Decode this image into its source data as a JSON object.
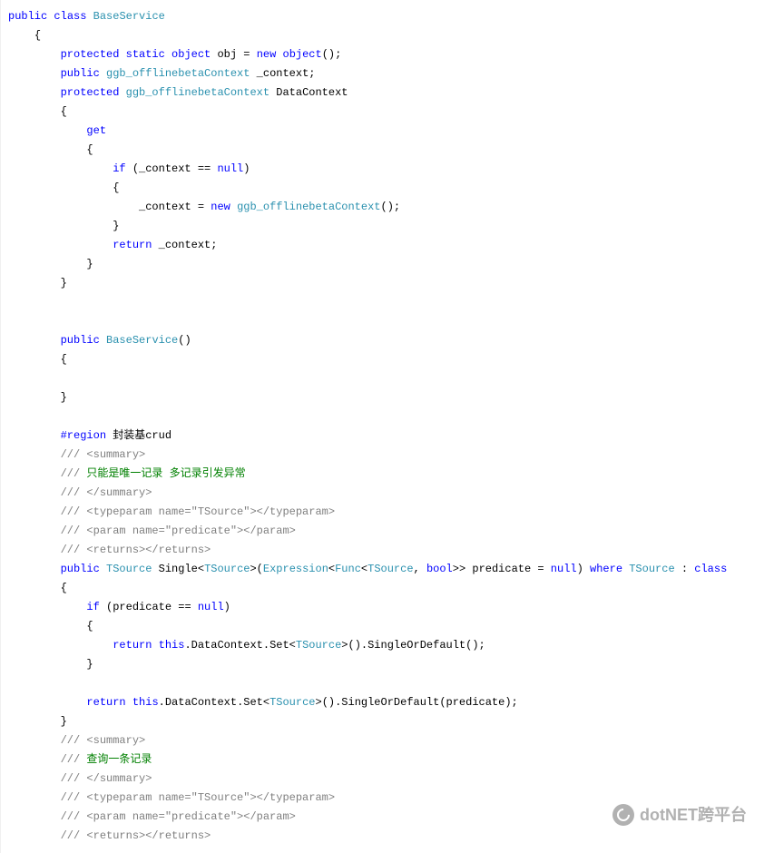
{
  "code": {
    "tokens": [
      [
        [
          0,
          "kw",
          "public"
        ],
        [
          0,
          "t",
          " "
        ],
        [
          0,
          "kw",
          "class"
        ],
        [
          0,
          "t",
          " "
        ],
        [
          0,
          "type",
          "BaseService"
        ]
      ],
      [
        [
          1,
          "t",
          "{"
        ]
      ],
      [
        [
          2,
          "kw",
          "protected"
        ],
        [
          2,
          "t",
          " "
        ],
        [
          2,
          "kw",
          "static"
        ],
        [
          2,
          "t",
          " "
        ],
        [
          2,
          "kw",
          "object"
        ],
        [
          2,
          "t",
          " obj = "
        ],
        [
          2,
          "kw",
          "new"
        ],
        [
          2,
          "t",
          " "
        ],
        [
          2,
          "kw",
          "object"
        ],
        [
          2,
          "t",
          "();"
        ]
      ],
      [
        [
          2,
          "kw",
          "public"
        ],
        [
          2,
          "t",
          " "
        ],
        [
          2,
          "type",
          "ggb_offlinebetaContext"
        ],
        [
          2,
          "t",
          " _context;"
        ]
      ],
      [
        [
          2,
          "kw",
          "protected"
        ],
        [
          2,
          "t",
          " "
        ],
        [
          2,
          "type",
          "ggb_offlinebetaContext"
        ],
        [
          2,
          "t",
          " DataContext"
        ]
      ],
      [
        [
          2,
          "t",
          "{"
        ]
      ],
      [
        [
          3,
          "kw",
          "get"
        ]
      ],
      [
        [
          3,
          "t",
          "{"
        ]
      ],
      [
        [
          4,
          "kw",
          "if"
        ],
        [
          4,
          "t",
          " (_context == "
        ],
        [
          4,
          "kw",
          "null"
        ],
        [
          4,
          "t",
          ")"
        ]
      ],
      [
        [
          4,
          "t",
          "{"
        ]
      ],
      [
        [
          5,
          "t",
          "_context = "
        ],
        [
          5,
          "kw",
          "new"
        ],
        [
          5,
          "t",
          " "
        ],
        [
          5,
          "type",
          "ggb_offlinebetaContext"
        ],
        [
          5,
          "t",
          "();"
        ]
      ],
      [
        [
          4,
          "t",
          "}"
        ]
      ],
      [
        [
          4,
          "kw",
          "return"
        ],
        [
          4,
          "t",
          " _context;"
        ]
      ],
      [
        [
          3,
          "t",
          "}"
        ]
      ],
      [
        [
          2,
          "t",
          "}"
        ]
      ],
      [
        [
          2,
          "t",
          ""
        ]
      ],
      [
        [
          2,
          "t",
          ""
        ]
      ],
      [
        [
          2,
          "kw",
          "public"
        ],
        [
          2,
          "t",
          " "
        ],
        [
          2,
          "type",
          "BaseService"
        ],
        [
          2,
          "t",
          "()"
        ]
      ],
      [
        [
          2,
          "t",
          "{"
        ]
      ],
      [
        [
          2,
          "t",
          ""
        ]
      ],
      [
        [
          2,
          "t",
          "}"
        ]
      ],
      [
        [
          2,
          "t",
          ""
        ]
      ],
      [
        [
          2,
          "kw",
          "#region"
        ],
        [
          2,
          "t",
          " 封装基crud"
        ]
      ],
      [
        [
          2,
          "cmt",
          "/// <summary>"
        ]
      ],
      [
        [
          2,
          "cmt",
          "/// "
        ],
        [
          2,
          "grn",
          "只能是唯一记录 多记录引发异常"
        ]
      ],
      [
        [
          2,
          "cmt",
          "/// </summary>"
        ]
      ],
      [
        [
          2,
          "cmt",
          "/// <typeparam name=\"TSource\"></typeparam>"
        ]
      ],
      [
        [
          2,
          "cmt",
          "/// <param name=\"predicate\"></param>"
        ]
      ],
      [
        [
          2,
          "cmt",
          "/// <returns></returns>"
        ]
      ],
      [
        [
          2,
          "kw",
          "public"
        ],
        [
          2,
          "t",
          " "
        ],
        [
          2,
          "type",
          "TSource"
        ],
        [
          2,
          "t",
          " Single<"
        ],
        [
          2,
          "type",
          "TSource"
        ],
        [
          2,
          "t",
          ">("
        ],
        [
          2,
          "type",
          "Expression"
        ],
        [
          2,
          "t",
          "<"
        ],
        [
          2,
          "type",
          "Func"
        ],
        [
          2,
          "t",
          "<"
        ],
        [
          2,
          "type",
          "TSource"
        ],
        [
          2,
          "t",
          ", "
        ],
        [
          2,
          "kw",
          "bool"
        ],
        [
          2,
          "t",
          ">> predicate = "
        ],
        [
          2,
          "kw",
          "null"
        ],
        [
          2,
          "t",
          ") "
        ],
        [
          2,
          "kw",
          "where"
        ],
        [
          2,
          "t",
          " "
        ],
        [
          2,
          "type",
          "TSource"
        ],
        [
          2,
          "t",
          " : "
        ],
        [
          2,
          "kw",
          "class"
        ]
      ],
      [
        [
          2,
          "t",
          "{"
        ]
      ],
      [
        [
          3,
          "kw",
          "if"
        ],
        [
          3,
          "t",
          " (predicate == "
        ],
        [
          3,
          "kw",
          "null"
        ],
        [
          3,
          "t",
          ")"
        ]
      ],
      [
        [
          3,
          "t",
          "{"
        ]
      ],
      [
        [
          4,
          "kw",
          "return"
        ],
        [
          4,
          "t",
          " "
        ],
        [
          4,
          "kw",
          "this"
        ],
        [
          4,
          "t",
          ".DataContext.Set<"
        ],
        [
          4,
          "type",
          "TSource"
        ],
        [
          4,
          "t",
          ">().SingleOrDefault();"
        ]
      ],
      [
        [
          3,
          "t",
          "}"
        ]
      ],
      [
        [
          3,
          "t",
          ""
        ]
      ],
      [
        [
          3,
          "kw",
          "return"
        ],
        [
          3,
          "t",
          " "
        ],
        [
          3,
          "kw",
          "this"
        ],
        [
          3,
          "t",
          ".DataContext.Set<"
        ],
        [
          3,
          "type",
          "TSource"
        ],
        [
          3,
          "t",
          ">().SingleOrDefault(predicate);"
        ]
      ],
      [
        [
          2,
          "t",
          "}"
        ]
      ],
      [
        [
          2,
          "cmt",
          "/// <summary>"
        ]
      ],
      [
        [
          2,
          "cmt",
          "/// "
        ],
        [
          2,
          "grn",
          "查询一条记录"
        ]
      ],
      [
        [
          2,
          "cmt",
          "/// </summary>"
        ]
      ],
      [
        [
          2,
          "cmt",
          "/// <typeparam name=\"TSource\"></typeparam>"
        ]
      ],
      [
        [
          2,
          "cmt",
          "/// <param name=\"predicate\"></param>"
        ]
      ],
      [
        [
          2,
          "cmt",
          "/// <returns></returns>"
        ]
      ]
    ]
  },
  "indent_unit": "    ",
  "watermark_text": "dotNET跨平台"
}
